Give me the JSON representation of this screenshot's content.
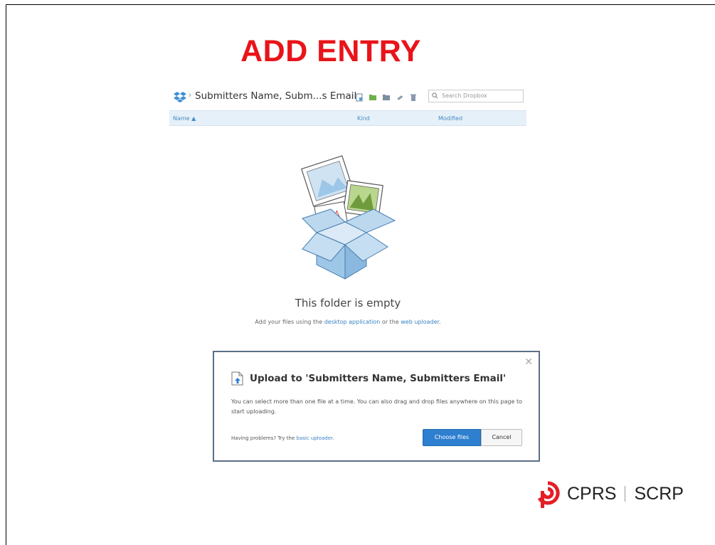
{
  "slide": {
    "title": "ADD ENTRY"
  },
  "dropbox": {
    "breadcrumb": "Submitters Name, Subm...s Email",
    "search_placeholder": "Search Dropbox",
    "columns": {
      "name": "Name ▲",
      "kind": "Kind",
      "modified": "Modified"
    },
    "empty_title": "This folder is empty",
    "empty_sub_prefix": "Add your files using the ",
    "empty_sub_link1": "desktop application",
    "empty_sub_mid": " or the ",
    "empty_sub_link2": "web uploader",
    "empty_sub_suffix": "."
  },
  "upload_dialog": {
    "close": "✕",
    "title": "Upload to 'Submitters Name, Submitters Email'",
    "body": "You can select more than one file at a time. You can also drag and drop files anywhere on this page to start uploading.",
    "help_prefix": "Having problems? Try the ",
    "help_link": "basic uploader",
    "help_suffix": ".",
    "choose_button": "Choose files",
    "cancel_button": "Cancel"
  },
  "branding": {
    "left": "CPRS",
    "right": "SCRP"
  },
  "colors": {
    "title_red": "#e8141a",
    "dropbox_blue": "#2e7fcf",
    "link_blue": "#3b82c4",
    "brand_red": "#e41e26"
  },
  "icons": [
    "dropbox-logo-icon",
    "new-file-icon",
    "new-folder-icon",
    "shared-folder-icon",
    "link-icon",
    "trash-icon",
    "search-icon",
    "upload-file-icon",
    "cprs-logo-icon"
  ]
}
